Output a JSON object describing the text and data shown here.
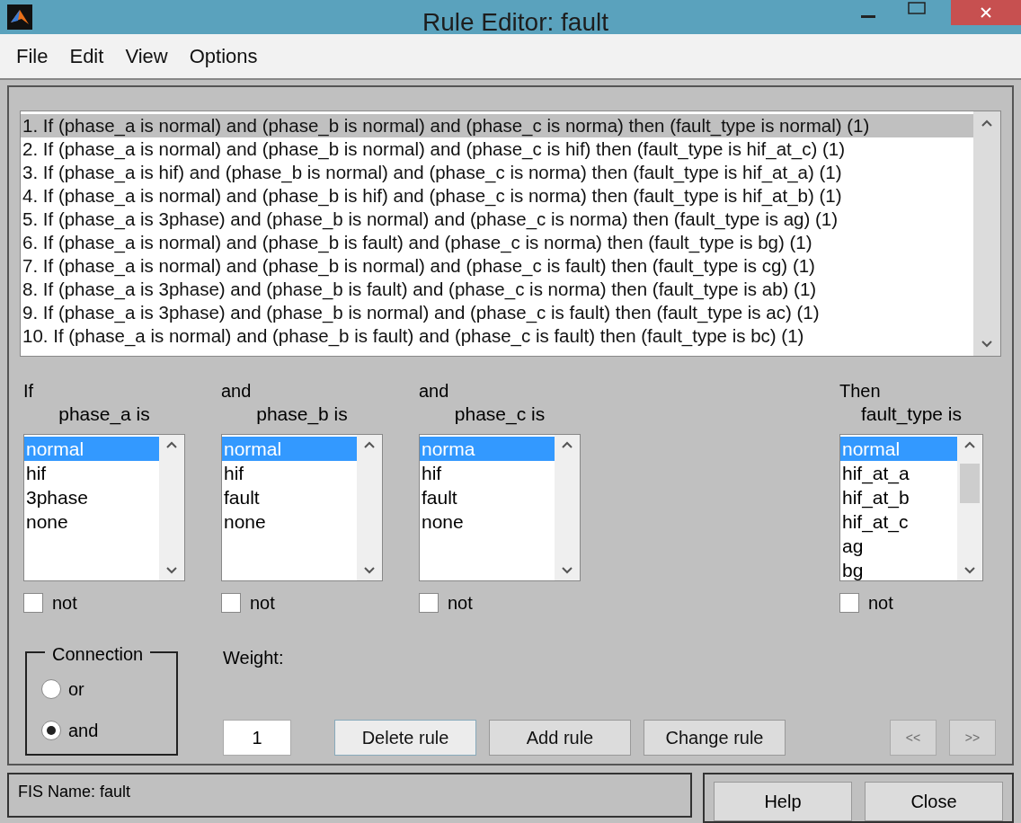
{
  "window": {
    "title": "Rule Editor: fault"
  },
  "menu": [
    "File",
    "Edit",
    "View",
    "Options"
  ],
  "rules": [
    {
      "text": "1. If (phase_a is normal) and (phase_b is normal) and (phase_c is norma) then (fault_type is normal) (1)",
      "selected": true
    },
    {
      "text": "2. If (phase_a is normal) and (phase_b is normal) and (phase_c is hif) then (fault_type is hif_at_c) (1)",
      "selected": false
    },
    {
      "text": "3. If (phase_a is hif) and (phase_b is normal) and (phase_c is norma) then (fault_type is hif_at_a) (1)",
      "selected": false
    },
    {
      "text": "4. If (phase_a is normal) and (phase_b is hif) and (phase_c is norma) then (fault_type is hif_at_b) (1)",
      "selected": false
    },
    {
      "text": "5. If (phase_a is 3phase) and (phase_b is normal) and (phase_c is norma) then (fault_type is ag) (1)",
      "selected": false
    },
    {
      "text": "6. If (phase_a is normal) and (phase_b is fault) and (phase_c is norma) then (fault_type is bg) (1)",
      "selected": false
    },
    {
      "text": "7. If (phase_a is normal) and (phase_b is normal) and (phase_c is fault) then (fault_type is cg) (1)",
      "selected": false
    },
    {
      "text": "8. If (phase_a is 3phase) and (phase_b is fault) and (phase_c is norma) then (fault_type is ab) (1)",
      "selected": false
    },
    {
      "text": "9. If (phase_a is 3phase) and (phase_b is normal) and (phase_c is fault) then (fault_type is ac) (1)",
      "selected": false
    },
    {
      "text": "10. If (phase_a is normal) and (phase_b is fault) and (phase_c is fault) then (fault_type is bc) (1)",
      "selected": false
    }
  ],
  "variables": [
    {
      "connector": "If",
      "name": "phase_a is",
      "options": [
        {
          "label": "normal",
          "selected": true
        },
        {
          "label": "hif",
          "selected": false
        },
        {
          "label": "3phase",
          "selected": false
        },
        {
          "label": "none",
          "selected": false
        }
      ],
      "not_label": "not",
      "not_checked": false,
      "scrollable": false
    },
    {
      "connector": "and",
      "name": "phase_b is",
      "options": [
        {
          "label": "normal",
          "selected": true
        },
        {
          "label": "hif",
          "selected": false
        },
        {
          "label": "fault",
          "selected": false
        },
        {
          "label": "none",
          "selected": false
        }
      ],
      "not_label": "not",
      "not_checked": false,
      "scrollable": false
    },
    {
      "connector": "and",
      "name": "phase_c is",
      "options": [
        {
          "label": "norma",
          "selected": true
        },
        {
          "label": "hif",
          "selected": false
        },
        {
          "label": "fault",
          "selected": false
        },
        {
          "label": "none",
          "selected": false
        }
      ],
      "not_label": "not",
      "not_checked": false,
      "scrollable": false
    },
    {
      "connector": "Then",
      "name": "fault_type is",
      "options": [
        {
          "label": "normal",
          "selected": true
        },
        {
          "label": "hif_at_a",
          "selected": false
        },
        {
          "label": "hif_at_b",
          "selected": false
        },
        {
          "label": "hif_at_c",
          "selected": false
        },
        {
          "label": "ag",
          "selected": false
        },
        {
          "label": "bg",
          "selected": false
        }
      ],
      "not_label": "not",
      "not_checked": false,
      "scrollable": true
    }
  ],
  "connection": {
    "title": "Connection",
    "options": [
      {
        "label": "or",
        "selected": false
      },
      {
        "label": "and",
        "selected": true
      }
    ]
  },
  "weight": {
    "label": "Weight:",
    "value": "1"
  },
  "buttons": [
    {
      "label": "Delete rule",
      "disabled": false,
      "focused": true
    },
    {
      "label": "Add rule",
      "disabled": false,
      "focused": false
    },
    {
      "label": "Change rule",
      "disabled": false,
      "focused": false
    }
  ],
  "nav_buttons": [
    {
      "label": "<<",
      "disabled": true
    },
    {
      "label": ">>",
      "disabled": true
    }
  ],
  "status": "FIS Name: fault",
  "footer_buttons": [
    "Help",
    "Close"
  ]
}
